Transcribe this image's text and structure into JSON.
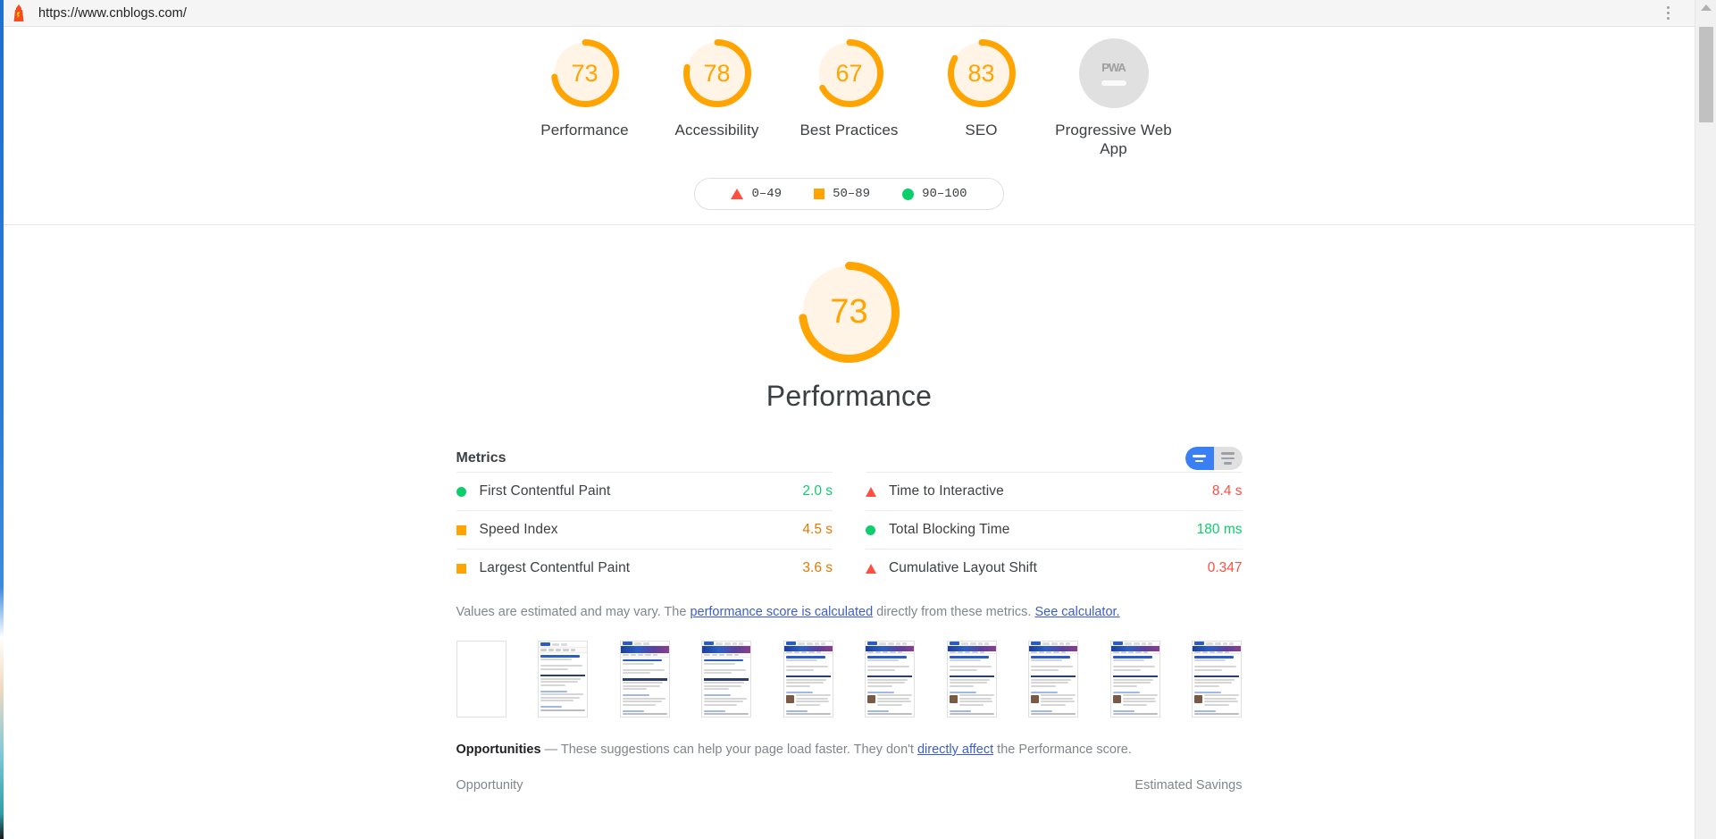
{
  "browser": {
    "url": "https://www.cnblogs.com/",
    "lighthouse_icon": "lighthouse-icon",
    "menu_icon": "kebab-menu-icon"
  },
  "header": {
    "scores": [
      {
        "value": "73",
        "label": "Performance",
        "pct": 73,
        "color": "#ffa400"
      },
      {
        "value": "78",
        "label": "Accessibility",
        "pct": 78,
        "color": "#ffa400"
      },
      {
        "value": "67",
        "label": "Best Practices",
        "pct": 67,
        "color": "#ffa400"
      },
      {
        "value": "83",
        "label": "SEO",
        "pct": 83,
        "color": "#ffa400"
      }
    ],
    "pwa": {
      "badge_text": "PWA",
      "label": "Progressive Web App"
    },
    "legend": [
      {
        "shape": "triangle",
        "range": "0–49",
        "color": "#ff4e42"
      },
      {
        "shape": "square",
        "range": "50–89",
        "color": "#ffa400"
      },
      {
        "shape": "circle",
        "range": "90–100",
        "color": "#0cce6b"
      }
    ]
  },
  "performance": {
    "score": "73",
    "score_pct": 73,
    "title": "Performance",
    "metrics_title": "Metrics",
    "toggle": {
      "simple_label": "simple-view",
      "expanded_label": "expanded-view"
    },
    "metrics_left": [
      {
        "name": "First Contentful Paint",
        "value": "2.0 s",
        "status": "pass",
        "shape": "circle"
      },
      {
        "name": "Speed Index",
        "value": "4.5 s",
        "status": "average",
        "shape": "square"
      },
      {
        "name": "Largest Contentful Paint",
        "value": "3.6 s",
        "status": "average",
        "shape": "square"
      }
    ],
    "metrics_right": [
      {
        "name": "Time to Interactive",
        "value": "8.4 s",
        "status": "fail",
        "shape": "triangle"
      },
      {
        "name": "Total Blocking Time",
        "value": "180 ms",
        "status": "pass",
        "shape": "circle"
      },
      {
        "name": "Cumulative Layout Shift",
        "value": "0.347",
        "status": "fail",
        "shape": "triangle"
      }
    ],
    "disclaimer": {
      "part1": "Values are estimated and may vary. The ",
      "link1": "performance score is calculated",
      "part2": " directly from these metrics. ",
      "link2": "See calculator."
    },
    "filmstrip_frames": 10
  },
  "opportunities": {
    "heading": "Opportunities",
    "dash": " — ",
    "intro1": "These suggestions can help your page load faster. They don't ",
    "intro_link": "directly affect",
    "intro2": " the Performance score.",
    "col_opportunity": "Opportunity",
    "col_savings": "Estimated Savings"
  },
  "colors": {
    "orange": "#ffa400",
    "green": "#0cce6b",
    "red": "#ff4e42",
    "blue": "#3b7ff5",
    "link": "#3c5dc9"
  }
}
